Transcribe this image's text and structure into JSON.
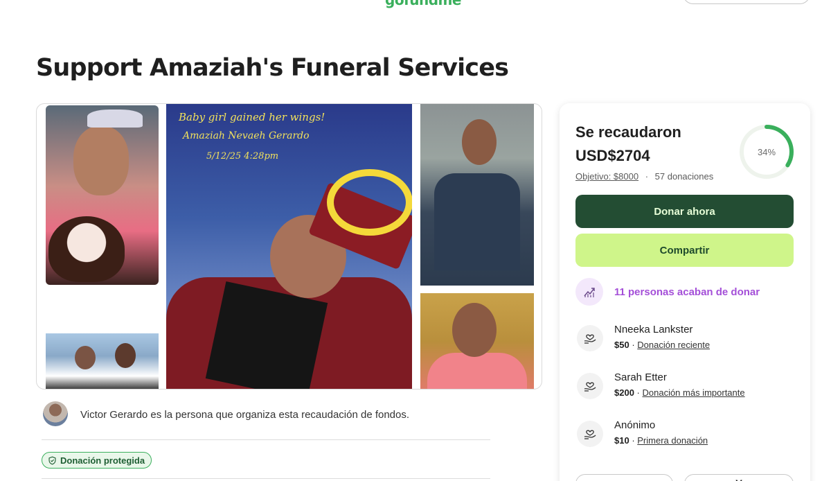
{
  "header": {
    "logo_text": "gofundme"
  },
  "campaign": {
    "title": "Support Amaziah's Funeral Services"
  },
  "photo_overlay": {
    "line1": "Baby girl gained her wings!",
    "line2": "Amaziah Nevaeh Gerardo",
    "line3": "5/12/25 4:28pm"
  },
  "organizer": {
    "text": "Victor Gerardo es la persona que organiza esta recaudación de fondos."
  },
  "badge": {
    "label": "Donación protegida"
  },
  "donation_card": {
    "raised_label": "Se recaudaron",
    "raised_amount": "USD$2704",
    "goal_label": "Objetivo: $8000",
    "separator": "·",
    "donation_count": "57 donaciones",
    "progress_label": "34%",
    "progress_fraction": 0.34,
    "donate_label": "Donar ahora",
    "share_label": "Compartir",
    "recent_activity": "11 personas acaban de donar",
    "donors": [
      {
        "name": "Nneeka Lankster",
        "amount": "$50",
        "tag": "Donación reciente"
      },
      {
        "name": "Sarah Etter",
        "amount": "$200",
        "tag": "Donación más importante"
      },
      {
        "name": "Anónimo",
        "amount": "$10",
        "tag": "Primera donación"
      }
    ],
    "bottom_buttons": [
      "",
      "V"
    ]
  },
  "colors": {
    "brand_green": "#3aaf5c",
    "donate_button": "#234d33",
    "share_button": "#cff58a",
    "activity_purple": "#a44fd8"
  }
}
